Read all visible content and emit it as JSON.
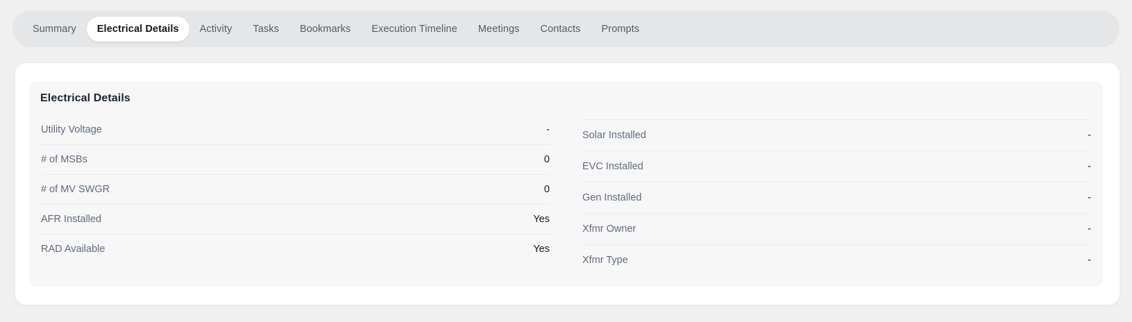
{
  "tabs": {
    "items": [
      {
        "label": "Summary",
        "active": false
      },
      {
        "label": "Electrical Details",
        "active": true
      },
      {
        "label": "Activity",
        "active": false
      },
      {
        "label": "Tasks",
        "active": false
      },
      {
        "label": "Bookmarks",
        "active": false
      },
      {
        "label": "Execution Timeline",
        "active": false
      },
      {
        "label": "Meetings",
        "active": false
      },
      {
        "label": "Contacts",
        "active": false
      },
      {
        "label": "Prompts",
        "active": false
      }
    ]
  },
  "details": {
    "title": "Electrical Details",
    "left": [
      {
        "label": "Utility Voltage",
        "value": "-"
      },
      {
        "label": "# of MSBs",
        "value": "0"
      },
      {
        "label": "# of MV SWGR",
        "value": "0"
      },
      {
        "label": "AFR Installed",
        "value": "Yes"
      },
      {
        "label": "RAD Available",
        "value": "Yes"
      }
    ],
    "right": [
      {
        "label": "Solar Installed",
        "value": "-"
      },
      {
        "label": "EVC Installed",
        "value": "-"
      },
      {
        "label": "Gen Installed",
        "value": "-"
      },
      {
        "label": "Xfmr Owner",
        "value": "-"
      },
      {
        "label": "Xfmr Type",
        "value": "-"
      }
    ]
  },
  "colors": {
    "page_bg": "#f0f0f0",
    "tabbar_bg": "#e5e6e8",
    "tab_text": "#545b64",
    "active_tab_bg": "#ffffff",
    "active_tab_text": "#16191f",
    "card_bg": "#ffffff",
    "panel_bg": "#f7f7f8",
    "label_text": "#5f6b7a",
    "value_text": "#16191f",
    "divider": "#e9ebed"
  }
}
